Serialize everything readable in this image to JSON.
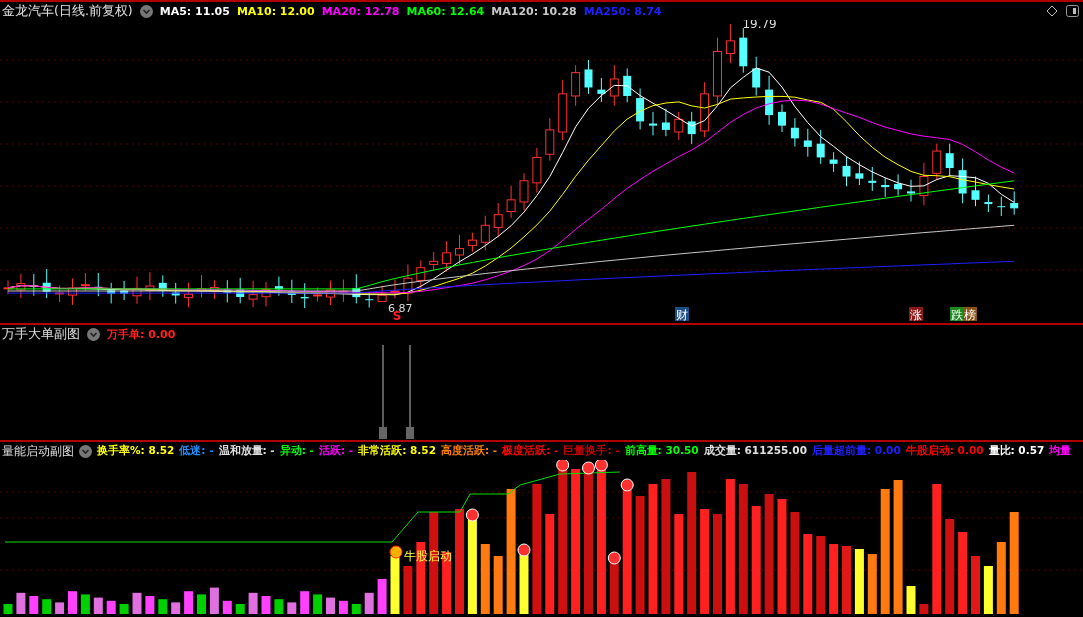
{
  "main_panel": {
    "title": "金龙汽车(日线.前复权)",
    "indicators": [
      {
        "label": "MA5: 11.05",
        "color": "#ffffff"
      },
      {
        "label": "MA10: 12.00",
        "color": "#ffff00"
      },
      {
        "label": "MA20: 12.78",
        "color": "#ff00ff"
      },
      {
        "label": "MA60: 12.64",
        "color": "#00ff00"
      },
      {
        "label": "MA120: 10.28",
        "color": "#c8c8c8"
      },
      {
        "label": "MA250: 8.74",
        "color": "#2020ff"
      }
    ],
    "high_label": "19.79",
    "low_label": "6.87",
    "markers": [
      {
        "text": "S",
        "kind": "arrow",
        "color": "#ff2020"
      },
      {
        "text": "财",
        "kind": "badge",
        "color": "#1c4e86"
      },
      {
        "text": "涨",
        "kind": "badge",
        "color": "#8a1818"
      },
      {
        "text": "跌",
        "kind": "badge",
        "color": "#1e8a1e"
      },
      {
        "text": "榜",
        "kind": "badge",
        "color": "#8a5418"
      }
    ]
  },
  "block_order_panel": {
    "title": "万手大单副图",
    "indicators": [
      {
        "label": "万手单: 0.00",
        "color": "#ff2020"
      }
    ]
  },
  "volume_panel": {
    "title": "量能启动副图",
    "indicators": [
      {
        "label": "换手率%: 8.52",
        "color": "#ffff00"
      },
      {
        "label": "低迷: -",
        "color": "#1e90ff"
      },
      {
        "label": "温和放量: -",
        "color": "#e0e0e0"
      },
      {
        "label": "异动: -",
        "color": "#00ff00"
      },
      {
        "label": "活跃: -",
        "color": "#ff00ff"
      },
      {
        "label": "非常活跃: 8.52",
        "color": "#ffff00"
      },
      {
        "label": "高度活跃: -",
        "color": "#ff8000"
      },
      {
        "label": "极度活跃: -",
        "color": "#ff0000"
      },
      {
        "label": "巨量换手: -",
        "color": "#c00000"
      },
      {
        "label": "前高量: 30.50",
        "color": "#00ff00"
      },
      {
        "label": "成交量: 611255.00",
        "color": "#e0e0e0"
      },
      {
        "label": "后量超前量: 0.00",
        "color": "#2020ff"
      },
      {
        "label": "牛股启动: 0.00",
        "color": "#ff0000"
      },
      {
        "label": "量比: 0.57",
        "color": "#ffffff"
      },
      {
        "label": "均量",
        "color": "#ff00ff"
      }
    ],
    "signal_label": "牛股启动"
  }
}
